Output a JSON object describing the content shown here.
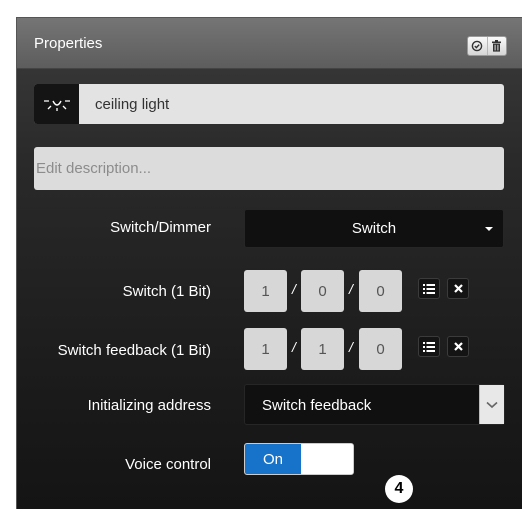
{
  "panel": {
    "title": "Properties",
    "check_icon": "check-circle-icon",
    "trash_icon": "trash-icon"
  },
  "device": {
    "icon": "ceiling-light-icon",
    "name": "ceiling light",
    "description_placeholder": "Edit description..."
  },
  "fields": {
    "switch_dimmer": {
      "label": "Switch/Dimmer",
      "value": "Switch"
    },
    "switch_1bit": {
      "label": "Switch (1 Bit)",
      "address": [
        "1",
        "0",
        "0"
      ]
    },
    "switch_feedback": {
      "label": "Switch feedback (1 Bit)",
      "address": [
        "1",
        "1",
        "0"
      ]
    },
    "init_address": {
      "label": "Initializing address",
      "value": "Switch feedback"
    },
    "voice_control": {
      "label": "Voice control",
      "value": "On"
    }
  },
  "callout": "4",
  "colors": {
    "accent": "#1773c9",
    "panel_bg": "#1a1a1a",
    "header_bg": "#6a6a6a"
  }
}
